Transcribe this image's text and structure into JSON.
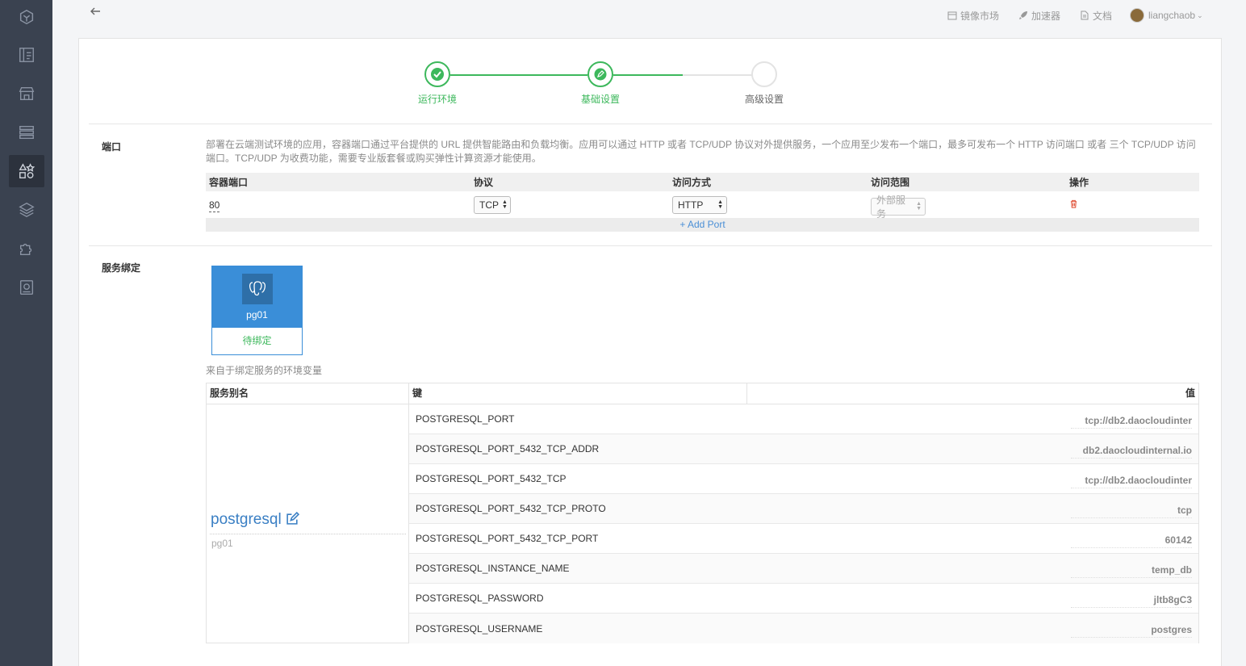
{
  "topnav": {
    "market": "镜像市场",
    "accelerator": "加速器",
    "docs": "文档",
    "user": "liangchaob"
  },
  "stepper": {
    "steps": [
      {
        "label": "运行环境",
        "state": "done"
      },
      {
        "label": "基础设置",
        "state": "active"
      },
      {
        "label": "高级设置",
        "state": "pending"
      }
    ]
  },
  "ports": {
    "title": "端口",
    "description": "部署在云端测试环境的应用，容器端口通过平台提供的 URL 提供智能路由和负载均衡。应用可以通过 HTTP 或者 TCP/UDP 协议对外提供服务，一个应用至少发布一个端口，最多可发布一个 HTTP 访问端口 或者 三个 TCP/UDP 访问端口。TCP/UDP 为收费功能，需要专业版套餐或购买弹性计算资源才能使用。",
    "columns": [
      "容器端口",
      "协议",
      "访问方式",
      "访问范围",
      "操作"
    ],
    "row": {
      "port": "80",
      "protocol": "TCP",
      "access": "HTTP",
      "scope": "外部服务"
    },
    "add_port": "+ Add Port"
  },
  "binding": {
    "title": "服务绑定",
    "service_name": "pg01",
    "service_status": "待绑定",
    "env_caption": "来自于绑定服务的环境变量",
    "columns": [
      "服务别名",
      "键",
      "值"
    ],
    "alias": "postgresql",
    "alias_sub": "pg01",
    "env": [
      {
        "key": "POSTGRESQL_PORT",
        "value": "tcp://db2.daocloudinter"
      },
      {
        "key": "POSTGRESQL_PORT_5432_TCP_ADDR",
        "value": "db2.daocloudinternal.io"
      },
      {
        "key": "POSTGRESQL_PORT_5432_TCP",
        "value": "tcp://db2.daocloudinter"
      },
      {
        "key": "POSTGRESQL_PORT_5432_TCP_PROTO",
        "value": "tcp"
      },
      {
        "key": "POSTGRESQL_PORT_5432_TCP_PORT",
        "value": "60142"
      },
      {
        "key": "POSTGRESQL_INSTANCE_NAME",
        "value": "temp_db"
      },
      {
        "key": "POSTGRESQL_PASSWORD",
        "value": "jltb8gC3"
      },
      {
        "key": "POSTGRESQL_USERNAME",
        "value": "postgres"
      }
    ]
  },
  "colors": {
    "sidebar": "#3a4250",
    "success": "#3db85c",
    "primary": "#3a8ed8",
    "danger": "#e0533a"
  }
}
